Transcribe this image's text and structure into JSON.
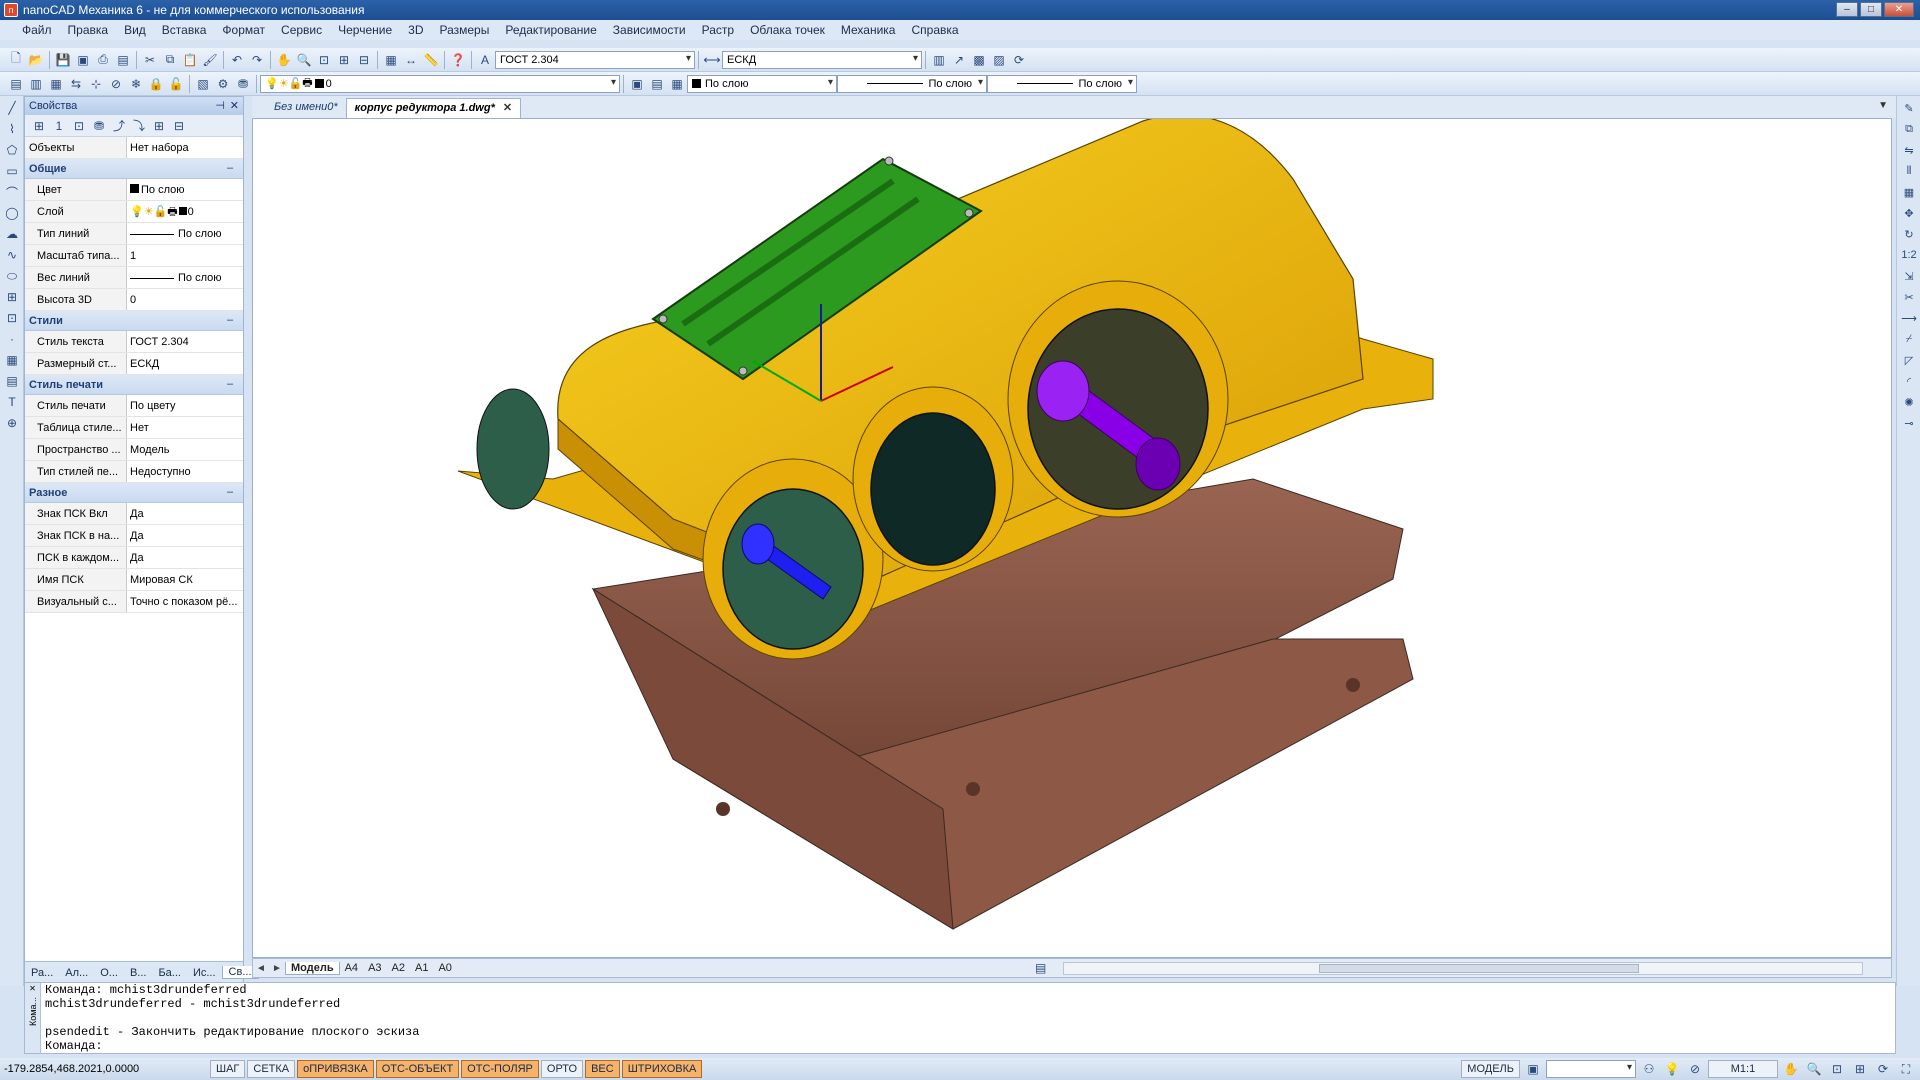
{
  "window": {
    "title": "nanoCAD Механика 6 - не для коммерческого использования"
  },
  "menu": [
    "Файл",
    "Правка",
    "Вид",
    "Вставка",
    "Формат",
    "Сервис",
    "Черчение",
    "3D",
    "Размеры",
    "Редактирование",
    "Зависимости",
    "Растр",
    "Облака точек",
    "Механика",
    "Справка"
  ],
  "toolbar1": {
    "text_style": "ГОСТ 2.304",
    "dim_style": "ЕСКД"
  },
  "toolbar2": {
    "layer": "0",
    "color": "По слою",
    "linetype": "По слою",
    "lineweight": "По слою"
  },
  "properties": {
    "title": "Свойства",
    "objects_label": "Объекты",
    "objects_value": "Нет набора",
    "sections": [
      {
        "name": "Общие",
        "rows": [
          {
            "k": "Цвет",
            "v": "По слою"
          },
          {
            "k": "Слой",
            "v": "0"
          },
          {
            "k": "Тип линий",
            "v": "По слою"
          },
          {
            "k": "Масштаб типа...",
            "v": "1"
          },
          {
            "k": "Вес линий",
            "v": "По слою"
          },
          {
            "k": "Высота 3D",
            "v": "0"
          }
        ]
      },
      {
        "name": "Стили",
        "rows": [
          {
            "k": "Стиль текста",
            "v": "ГОСТ 2.304"
          },
          {
            "k": "Размерный ст...",
            "v": "ЕСКД"
          }
        ]
      },
      {
        "name": "Стиль печати",
        "rows": [
          {
            "k": "Стиль печати",
            "v": "По цвету"
          },
          {
            "k": "Таблица стиле...",
            "v": "Нет"
          },
          {
            "k": "Пространство ...",
            "v": "Модель"
          },
          {
            "k": "Тип стилей пе...",
            "v": "Недоступно"
          }
        ]
      },
      {
        "name": "Разное",
        "rows": [
          {
            "k": "Знак ПСК Вкл",
            "v": "Да"
          },
          {
            "k": "Знак ПСК в на...",
            "v": "Да"
          },
          {
            "k": "ПСК в каждом...",
            "v": "Да"
          },
          {
            "k": "Имя ПСК",
            "v": "Мировая СК"
          },
          {
            "k": "Визуальный с...",
            "v": "Точно с показом рё..."
          }
        ]
      }
    ],
    "bottom_tabs": [
      "Ра...",
      "Ал...",
      "О...",
      "В...",
      "Ба...",
      "Ис...",
      "Св..."
    ]
  },
  "doc_tabs": [
    {
      "label": "Без имени0*"
    },
    {
      "label": "корпус редуктора 1.dwg*"
    }
  ],
  "layout_tabs": [
    "Модель",
    "А4",
    "А3",
    "А2",
    "А1",
    "А0"
  ],
  "command_lines": [
    "Команда: mchist3drundeferred",
    "mchist3drundeferred - mchist3drundeferred",
    "",
    "psendedit - Закончить редактирование плоского эскиза",
    "Команда:"
  ],
  "command_side_label": "Кома...",
  "status": {
    "coords": "-179.2854,468.2021,0.0000",
    "toggles": [
      {
        "label": "ШАГ",
        "on": false
      },
      {
        "label": "СЕТКА",
        "on": false
      },
      {
        "label": "оПРИВЯЗКА",
        "on": true
      },
      {
        "label": "ОТС-ОБЪЕКТ",
        "on": true
      },
      {
        "label": "ОТС-ПОЛЯР",
        "on": true
      },
      {
        "label": "ОРТО",
        "on": false
      },
      {
        "label": "ВЕС",
        "on": true
      },
      {
        "label": "ШТРИХОВКА",
        "on": true
      }
    ],
    "space": "МОДЕЛЬ",
    "scale": "М1:1"
  },
  "model_colors": {
    "housing": "#f2c016",
    "base": "#8a5544",
    "cover": "#2b9a1e",
    "shaft_purple": "#8a00e6",
    "shaft_blue": "#1f1ff0",
    "flange": "#2d5e4a"
  }
}
